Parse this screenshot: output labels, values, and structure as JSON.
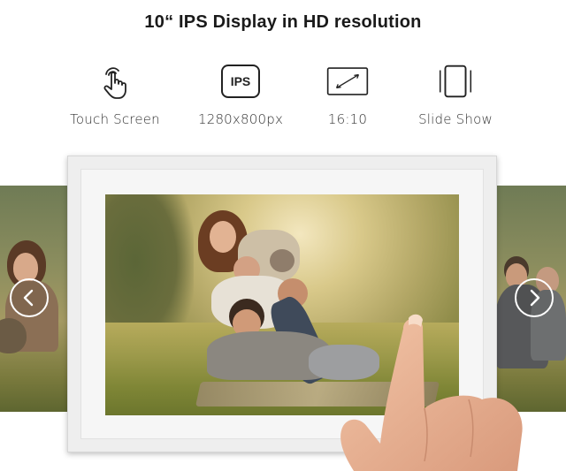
{
  "headline": "10“ IPS Display in HD resolution",
  "features": [
    {
      "icon": "touch-hand-icon",
      "label": "Touch Screen"
    },
    {
      "icon": "ips-badge-icon",
      "badge": "IPS",
      "label": "1280x800px"
    },
    {
      "icon": "aspect-ratio-icon",
      "label": "16:10"
    },
    {
      "icon": "slide-show-icon",
      "label": "Slide Show"
    }
  ],
  "slideshow": {
    "prev_icon": "chevron-left-icon",
    "next_icon": "chevron-right-icon"
  },
  "colors": {
    "headline": "#1a1a1a",
    "label": "#333333",
    "frame": "#eeeeee"
  }
}
